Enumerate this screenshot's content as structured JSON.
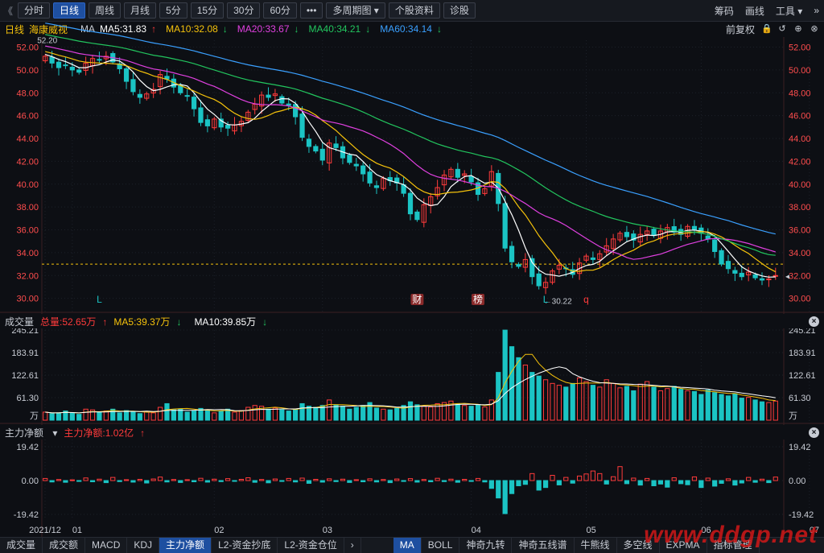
{
  "toolbar": {
    "tabs": [
      "分时",
      "日线",
      "周线",
      "月线",
      "5分",
      "15分",
      "30分",
      "60分"
    ],
    "active_tab": "日线",
    "more": "•••",
    "multi_period": "多周期图",
    "stock_info": "个股资料",
    "diagnose": "诊股",
    "right": [
      "筹码",
      "画线",
      "工具"
    ]
  },
  "info": {
    "period": "日线",
    "name": "海康威视",
    "ma_label": "MA",
    "ma5": "MA5:31.83",
    "ma10": "MA10:32.08",
    "ma20": "MA20:33.67",
    "ma40": "MA40:34.21",
    "ma60": "MA60:34.14",
    "adjust": "前复权"
  },
  "colors": {
    "up": "#ff3b3b",
    "down": "#1bc4c4",
    "ma5": "#ffffff",
    "ma10": "#f5c20b",
    "ma20": "#e040e0",
    "ma40": "#22c55e",
    "ma60": "#3aa0ff",
    "ref_line": "#f5c20b"
  },
  "volume_header": {
    "title": "成交量",
    "total": "总量:52.65万",
    "ma5": "MA5:39.37万",
    "ma10": "MA10:39.85万"
  },
  "flow_header": {
    "title": "主力净额",
    "value": "主力净额:1.02亿"
  },
  "bottom_tabs_left": [
    "成交量",
    "成交额",
    "MACD",
    "KDJ",
    "主力净额",
    "L2-资金抄底",
    "L2-资金仓位"
  ],
  "bottom_tabs_right": [
    "MA",
    "BOLL",
    "神奇九转",
    "神奇五线谱",
    "牛熊线",
    "多空线",
    "EXPMA",
    "指标管理"
  ],
  "active_bottom_left": "主力净额",
  "active_bottom_right": "MA",
  "markers": {
    "high_label": "52.20",
    "low_label": "30.22",
    "events": [
      "L",
      "财",
      "榜",
      "L",
      "q"
    ]
  },
  "watermark": "www.ddgp.net",
  "chart_data": [
    {
      "type": "candlestick",
      "title": "海康威视 日线",
      "y_ticks": [
        "52.00",
        "50.00",
        "48.00",
        "46.00",
        "44.00",
        "42.00",
        "40.00",
        "38.00",
        "36.00",
        "34.00",
        "32.00",
        "30.00"
      ],
      "ylim": [
        29.2,
        52.6
      ],
      "x_ticks": [
        "2021/12",
        "01",
        "02",
        "03",
        "04",
        "05",
        "06",
        "07"
      ],
      "reference_line": 33.0,
      "high": 52.2,
      "low": 30.22,
      "closes": [
        51.2,
        50.6,
        50.2,
        50.4,
        50.0,
        49.8,
        50.6,
        51.0,
        50.9,
        51.2,
        50.7,
        50.1,
        49.0,
        48.1,
        47.6,
        47.9,
        48.3,
        49.6,
        49.2,
        48.5,
        48.0,
        47.7,
        46.6,
        45.4,
        45.1,
        45.7,
        45.0,
        44.9,
        45.2,
        45.5,
        46.3,
        47.0,
        47.8,
        47.6,
        47.9,
        47.1,
        46.9,
        45.9,
        44.1,
        43.3,
        42.9,
        42.1,
        43.6,
        43.2,
        42.3,
        41.9,
        41.6,
        40.9,
        40.1,
        39.7,
        40.5,
        40.3,
        40.1,
        39.2,
        37.4,
        36.9,
        38.2,
        38.9,
        39.7,
        40.8,
        41.3,
        40.6,
        40.9,
        40.2,
        39.1,
        39.6,
        41.1,
        38.3,
        34.4,
        33.2,
        32.8,
        33.4,
        31.9,
        31.1,
        31.4,
        32.4,
        32.9,
        32.6,
        32.1,
        33.1,
        33.7,
        33.4,
        33.9,
        34.6,
        35.2,
        35.7,
        35.4,
        35.1,
        35.6,
        35.9,
        35.5,
        35.9,
        36.2,
        35.8,
        35.6,
        36.3,
        36.0,
        35.7,
        35.2,
        34.1,
        33.0,
        32.6,
        32.2,
        31.9,
        32.3,
        31.8,
        31.6,
        31.7,
        32.0
      ]
    },
    {
      "type": "bar",
      "title": "成交量",
      "y_ticks": [
        "245.21",
        "183.91",
        "122.61",
        "61.30",
        "万"
      ],
      "ylim": [
        0,
        245.21
      ],
      "values": [
        22,
        18,
        20,
        25,
        19,
        16,
        30,
        28,
        22,
        25,
        30,
        20,
        26,
        22,
        18,
        24,
        20,
        35,
        45,
        28,
        30,
        22,
        25,
        32,
        28,
        20,
        24,
        30,
        22,
        26,
        35,
        40,
        38,
        30,
        33,
        28,
        25,
        30,
        45,
        38,
        35,
        40,
        55,
        42,
        38,
        30,
        35,
        40,
        48,
        33,
        30,
        28,
        32,
        40,
        50,
        42,
        38,
        36,
        45,
        48,
        52,
        44,
        40,
        38,
        42,
        36,
        55,
        130,
        245,
        200,
        170,
        150,
        130,
        120,
        110,
        100,
        95,
        90,
        100,
        115,
        105,
        95,
        90,
        110,
        100,
        88,
        92,
        80,
        98,
        105,
        90,
        80,
        86,
        92,
        84,
        80,
        78,
        70,
        82,
        75,
        70,
        66,
        72,
        60,
        62,
        55,
        50,
        48,
        52
      ]
    },
    {
      "type": "bar",
      "title": "主力净额",
      "y_ticks": [
        "19.42",
        "0.00",
        "-19.42"
      ],
      "ylim": [
        -19.42,
        19.42
      ],
      "values": [
        1.2,
        -0.8,
        0.6,
        -1.0,
        0.4,
        -0.5,
        1.5,
        -0.7,
        0.8,
        -1.2,
        1.8,
        -0.6,
        0.5,
        -0.9,
        0.7,
        -1.4,
        0.9,
        2.0,
        -0.8,
        0.6,
        -1.1,
        0.5,
        -0.7,
        1.3,
        -0.9,
        0.8,
        -0.6,
        1.1,
        -0.4,
        0.7,
        1.6,
        -1.0,
        0.6,
        -1.3,
        0.9,
        -0.5,
        1.2,
        -0.8,
        1.4,
        -1.6,
        0.7,
        -0.9,
        1.0,
        -0.6,
        0.8,
        -1.1,
        0.5,
        -0.7,
        1.0,
        -0.8,
        0.6,
        -1.2,
        0.9,
        -0.5,
        1.1,
        -0.9,
        0.6,
        -0.7,
        1.3,
        -0.6,
        0.8,
        -1.0,
        0.7,
        -0.5,
        1.2,
        -0.8,
        -4.5,
        -10.0,
        -19.0,
        -7.5,
        -3.0,
        -2.2,
        4.0,
        -5.5,
        -4.0,
        3.0,
        -2.5,
        1.8,
        -1.5,
        2.6,
        3.8,
        5.5,
        4.0,
        -2.0,
        2.2,
        8.0,
        -1.8,
        1.4,
        -2.6,
        1.2,
        -3.0,
        -2.0,
        -3.8,
        1.6,
        -1.8,
        -2.4,
        2.1,
        -4.0,
        1.4,
        -3.2,
        -1.6,
        1.0,
        -2.6,
        -1.4,
        1.8,
        -1.0,
        0.8,
        -1.2,
        2.0
      ]
    }
  ]
}
